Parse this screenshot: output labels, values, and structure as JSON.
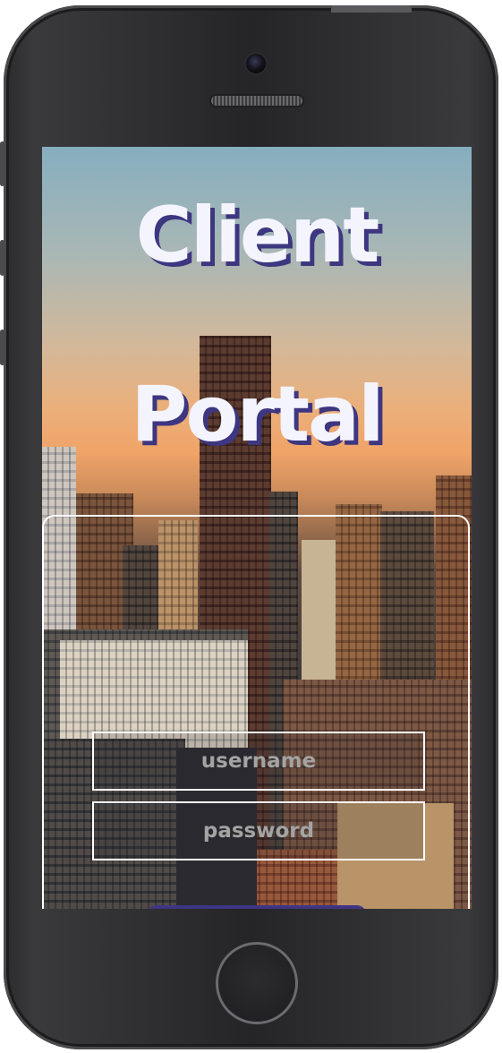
{
  "device": {
    "body_color": "#2b2b2d",
    "home_button_icon": "home-button"
  },
  "login": {
    "title_line1": "Client",
    "title_line2": "Portal",
    "username_placeholder": "username",
    "password_placeholder": "password",
    "accent_color": "#3f3585",
    "title_color": "#f4f4ff"
  }
}
